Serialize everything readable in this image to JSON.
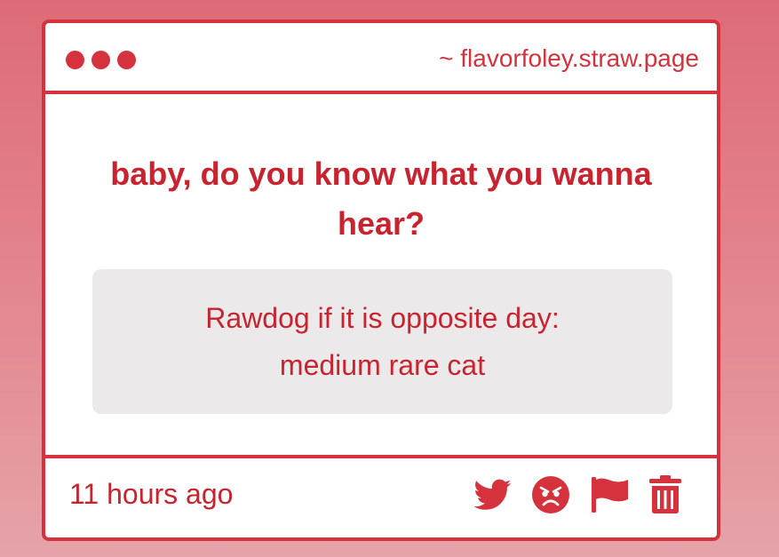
{
  "window": {
    "site_url": "~ flavorfoley.straw.page"
  },
  "post": {
    "question_line1": "baby, do you know what you wanna",
    "question_line2": "hear?",
    "answer_line1": "Rawdog if it is opposite day:",
    "answer_line2": "medium rare cat"
  },
  "footer": {
    "timestamp": "11 hours ago",
    "actions": [
      {
        "icon": "twitter-icon"
      },
      {
        "icon": "angry-face-icon"
      },
      {
        "icon": "flag-icon"
      },
      {
        "icon": "trash-icon"
      }
    ]
  },
  "colors": {
    "accent": "#d6323d",
    "text": "#c8232f",
    "answer_bg": "#ebe9ea",
    "background_top": "#dd6b76",
    "background_bottom": "#e6a3aa"
  }
}
